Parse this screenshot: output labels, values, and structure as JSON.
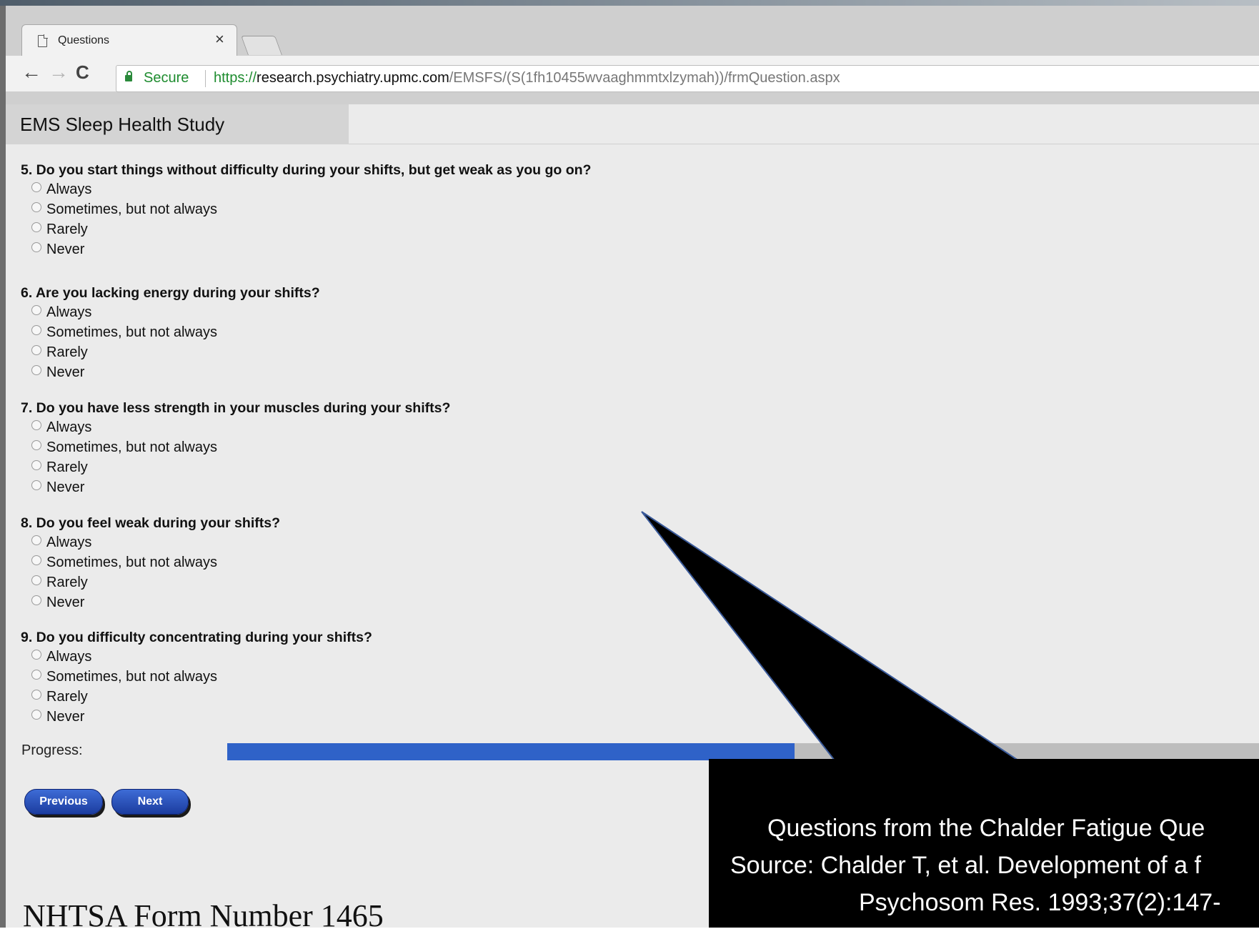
{
  "browser": {
    "tab_title": "Questions",
    "tab_close": "×",
    "back": "←",
    "forward": "→",
    "reload": "C",
    "secure_label": "Secure",
    "url_protocol": "https://",
    "url_host": "research.psychiatry.upmc.com",
    "url_path": "/EMSFS/(S(1fh10455wvaaghmmtxlzymah))/frmQuestion.aspx"
  },
  "page": {
    "header_title": "EMS Sleep Health Study",
    "questions": [
      {
        "text": "5. Do you start things without difficulty during your shifts, but get weak as you go on?",
        "options": [
          "Always",
          "Sometimes, but not always",
          "Rarely",
          "Never"
        ]
      },
      {
        "text": "6. Are you lacking energy during your shifts?",
        "options": [
          "Always",
          "Sometimes, but not always",
          "Rarely",
          "Never"
        ]
      },
      {
        "text": "7. Do you have less strength in your muscles during your shifts?",
        "options": [
          "Always",
          "Sometimes, but not always",
          "Rarely",
          "Never"
        ]
      },
      {
        "text": "8. Do you feel weak during your shifts?",
        "options": [
          "Always",
          "Sometimes, but not always",
          "Rarely",
          "Never"
        ]
      },
      {
        "text": "9. Do you difficulty concentrating during your shifts?",
        "options": [
          "Always",
          "Sometimes, but not always",
          "Rarely",
          "Never"
        ]
      }
    ],
    "progress_label": "Progress:",
    "progress_fraction": 0.55,
    "previous_label": "Previous",
    "next_label": "Next"
  },
  "overlay": {
    "footer_text": "NHTSA Form Number 1465",
    "callout_line1": "Questions from the Chalder Fatigue Que",
    "callout_line2": "Source: Chalder T, et al. Development of a f",
    "callout_line3": "Psychosom Res. 1993;37(2):147-"
  },
  "colors": {
    "progress_fill": "#2f62c8",
    "secure_green": "#1e8c2f",
    "callout_bg": "#000000"
  }
}
